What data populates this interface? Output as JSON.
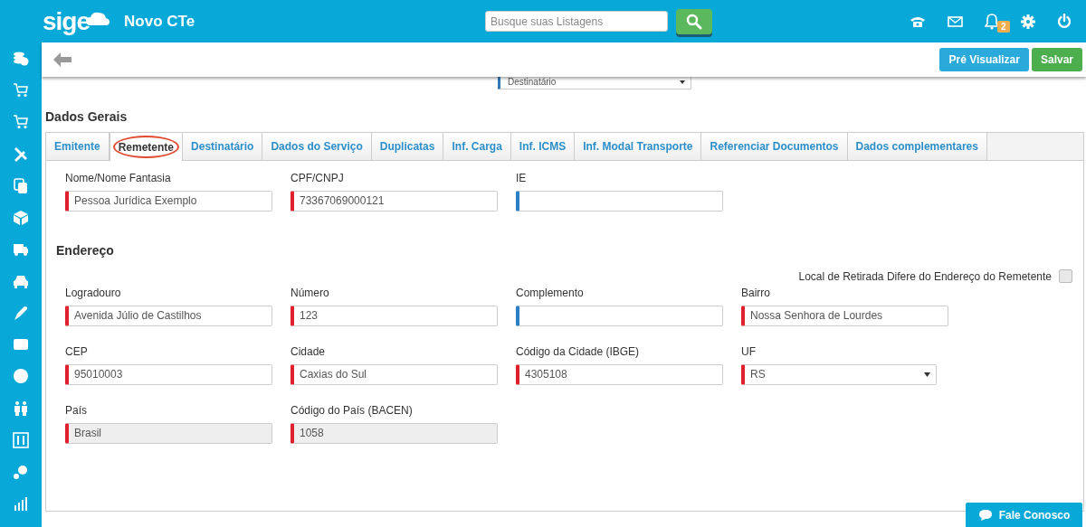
{
  "header": {
    "logo": "sige",
    "title": "Novo CTe",
    "search": {
      "placeholder": "Busque suas Listagens"
    },
    "notification_count": "2"
  },
  "toolbar": {
    "buttons": [
      {
        "label": "Pré Visualizar",
        "kind": "info"
      },
      {
        "label": "Salvar",
        "kind": "success"
      }
    ]
  },
  "top_select": {
    "value": "Destinatário"
  },
  "section_title": "Dados Gerais",
  "tabs": [
    {
      "label": "Emitente",
      "selected": false
    },
    {
      "label": "Remetente",
      "selected": true
    },
    {
      "label": "Destinatário",
      "selected": false
    },
    {
      "label": "Dados do Serviço",
      "selected": false
    },
    {
      "label": "Duplicatas",
      "selected": false
    },
    {
      "label": "Inf. Carga",
      "selected": false
    },
    {
      "label": "Inf. ICMS",
      "selected": false
    },
    {
      "label": "Inf. Modal Transporte",
      "selected": false
    },
    {
      "label": "Referenciar Documentos",
      "selected": false
    },
    {
      "label": "Dados complementares",
      "selected": false
    }
  ],
  "identity_fields": [
    {
      "label": "Nome/Nome Fantasia",
      "value": "Pessoa Jurídica Exemplo",
      "required": true,
      "disabled": false
    },
    {
      "label": "CPF/CNPJ",
      "value": "73367069000121",
      "required": true,
      "disabled": false
    },
    {
      "label": "IE",
      "required": false,
      "disabled": false
    }
  ],
  "address_title": "Endereço",
  "pickup_checkbox": {
    "label": "Local de Retirada Difere do Endereço do Remetente",
    "checked": false
  },
  "address_rows": [
    [
      {
        "label": "Logradouro",
        "value": "Avenida Júlio de Castilhos",
        "required": true,
        "disabled": false,
        "kind": "input"
      },
      {
        "label": "Número",
        "value": "123",
        "required": true,
        "disabled": false,
        "kind": "input"
      },
      {
        "label": "Complemento",
        "required": false,
        "disabled": false,
        "kind": "input"
      },
      {
        "label": "Bairro",
        "value": "Nossa Senhora de Lourdes",
        "required": true,
        "disabled": false,
        "kind": "input"
      }
    ],
    [
      {
        "label": "CEP",
        "value": "95010003",
        "required": true,
        "disabled": false,
        "kind": "input"
      },
      {
        "label": "Cidade",
        "value": "Caxias do Sul",
        "required": true,
        "disabled": false,
        "kind": "input"
      },
      {
        "label": "Código da Cidade (IBGE)",
        "value": "4305108",
        "required": true,
        "disabled": false,
        "kind": "input"
      },
      {
        "label": "UF",
        "value": "RS",
        "required": true,
        "disabled": false,
        "kind": "select"
      }
    ],
    [
      {
        "label": "País",
        "value": "Brasil",
        "required": true,
        "disabled": true,
        "kind": "input"
      },
      {
        "label": "Código do País (BACEN)",
        "value": "1058",
        "required": true,
        "disabled": true,
        "kind": "input"
      }
    ]
  ],
  "chat_button": "Fale Conosco"
}
